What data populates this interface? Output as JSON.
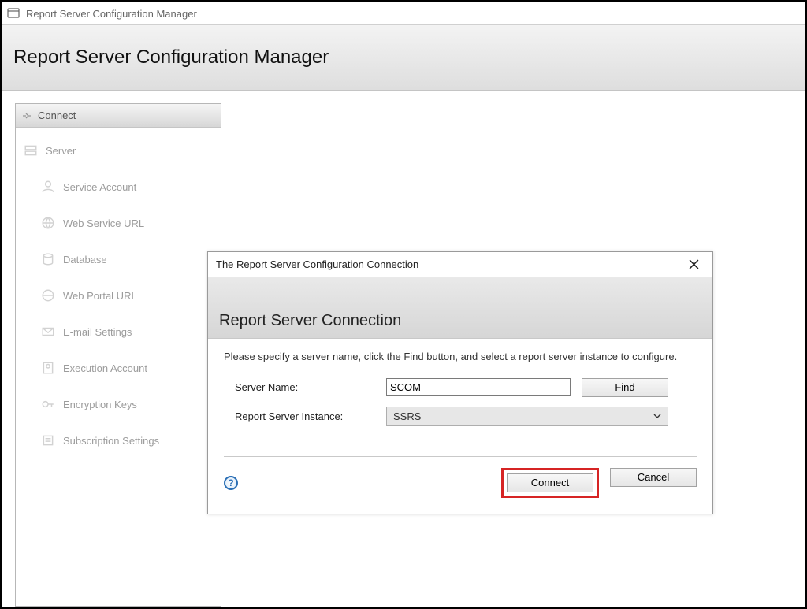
{
  "titlebar": {
    "title": "Report Server Configuration Manager"
  },
  "header": {
    "title": "Report Server Configuration Manager"
  },
  "sidebar": {
    "connect_label": "Connect",
    "items": [
      {
        "label": "Server",
        "sub": false
      },
      {
        "label": "Service Account",
        "sub": true
      },
      {
        "label": "Web Service URL",
        "sub": true
      },
      {
        "label": "Database",
        "sub": true
      },
      {
        "label": "Web Portal URL",
        "sub": true
      },
      {
        "label": "E-mail Settings",
        "sub": true
      },
      {
        "label": "Execution Account",
        "sub": true
      },
      {
        "label": "Encryption Keys",
        "sub": true
      },
      {
        "label": "Subscription Settings",
        "sub": true
      }
    ]
  },
  "dialog": {
    "window_title": "The Report Server Configuration Connection",
    "heading": "Report Server Connection",
    "instruction": "Please specify a server name, click the Find button, and select a report server instance to configure.",
    "server_name_label": "Server Name:",
    "server_name_value": "SCOM",
    "instance_label": "Report Server Instance:",
    "instance_value": "SSRS",
    "find_label": "Find",
    "connect_label": "Connect",
    "cancel_label": "Cancel"
  }
}
